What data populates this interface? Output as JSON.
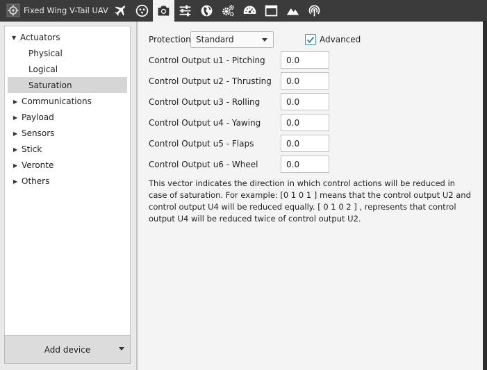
{
  "app": {
    "title": "Fixed Wing V-Tail UAV",
    "icon": "gear-icon"
  },
  "toolbar": {
    "buttons": [
      {
        "name": "airplane-icon",
        "active": false
      },
      {
        "name": "joystick-icon",
        "active": false
      },
      {
        "name": "camera-icon",
        "active": true
      },
      {
        "name": "sliders-icon",
        "active": false
      },
      {
        "name": "globe-icon",
        "active": false
      },
      {
        "name": "gears-icon",
        "active": false
      },
      {
        "name": "dashboard-icon",
        "active": false
      },
      {
        "name": "window-icon",
        "active": false
      },
      {
        "name": "mountains-icon",
        "active": false
      },
      {
        "name": "antenna-icon",
        "active": false
      }
    ]
  },
  "sidebar": {
    "items": [
      {
        "label": "Actuators",
        "expanded": true
      },
      {
        "label": "Physical"
      },
      {
        "label": "Logical"
      },
      {
        "label": "Saturation",
        "selected": true
      },
      {
        "label": "Communications",
        "expanded": false
      },
      {
        "label": "Payload",
        "expanded": false
      },
      {
        "label": "Sensors",
        "expanded": false
      },
      {
        "label": "Stick",
        "expanded": false
      },
      {
        "label": "Veronte",
        "expanded": false
      },
      {
        "label": "Others",
        "expanded": false
      }
    ],
    "add_device_label": "Add device"
  },
  "main": {
    "protection_label": "Protection",
    "protection_value": "Standard",
    "advanced_label": "Advanced",
    "advanced_checked": true,
    "outputs": [
      {
        "label": "Control Output u1 - Pitching",
        "value": "0.0"
      },
      {
        "label": "Control Output u2 - Thrusting",
        "value": "0.0"
      },
      {
        "label": "Control Output u3 - Rolling",
        "value": "0.0"
      },
      {
        "label": "Control Output u4 - Yawing",
        "value": "0.0"
      },
      {
        "label": "Control Output u5 - Flaps",
        "value": "0.0"
      },
      {
        "label": "Control Output u6 - Wheel",
        "value": "0.0"
      }
    ],
    "description": "This vector indicates the direction in which control actions will be reduced in case of saturation. For example: [0 1 0 1 ] means that the control output U2 and control output U4 will be reduced equally. [ 0 1 0 2 ] , represents that control output U4 will be reduced twice of control output U2."
  },
  "colors": {
    "toolbar_bg": "#3b3b3b",
    "accent": "#3a8fd1",
    "selected_row": "#d6d6d6"
  }
}
